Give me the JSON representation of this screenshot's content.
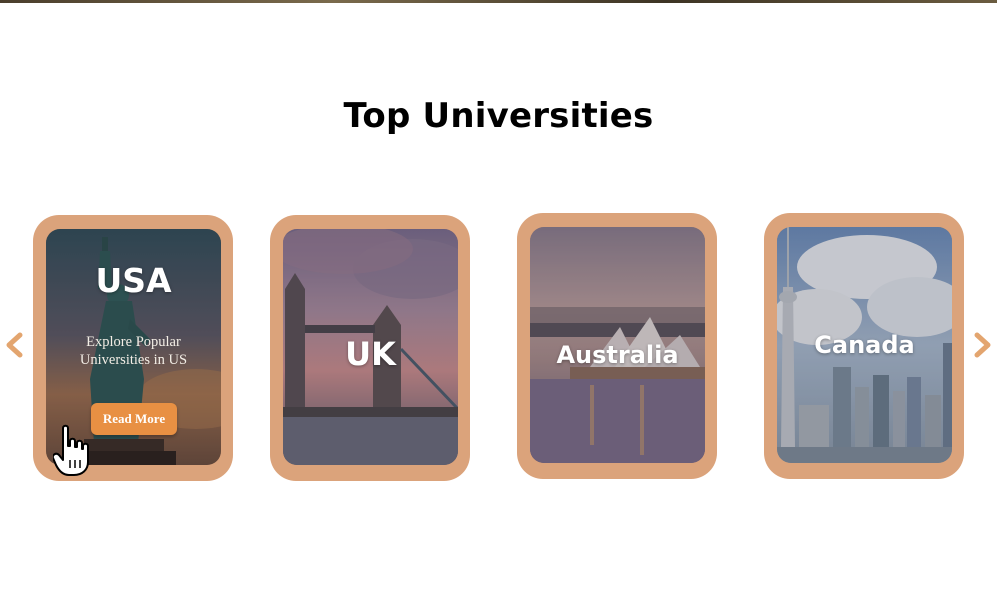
{
  "section": {
    "title": "Top Universities"
  },
  "carousel": {
    "cards": [
      {
        "country": "USA",
        "description": "Explore Popular Universities in US",
        "button_label": "Read More"
      },
      {
        "country": "UK"
      },
      {
        "country": "Australia"
      },
      {
        "country": "Canada"
      }
    ],
    "prev_icon": "chevron-left-icon",
    "next_icon": "chevron-right-icon"
  },
  "colors": {
    "card_frame": "#dba37b",
    "accent_button": "#e89043",
    "arrow": "#e3a56f",
    "title_text": "#000000"
  }
}
